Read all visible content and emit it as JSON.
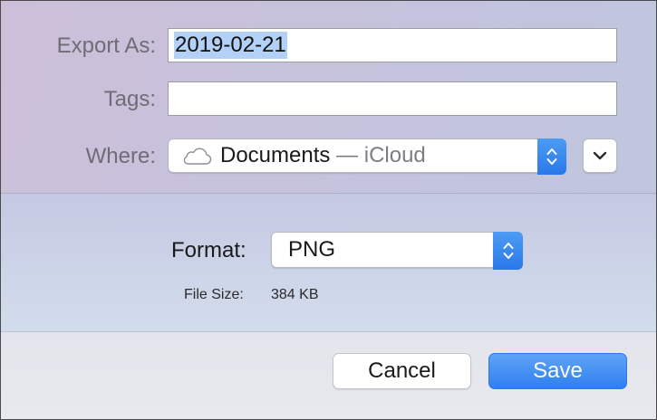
{
  "export_as": {
    "label": "Export As:",
    "value": "2019-02-21"
  },
  "tags": {
    "label": "Tags:",
    "value": ""
  },
  "where": {
    "label": "Where:",
    "location": "Documents",
    "separator": " — ",
    "service": "iCloud",
    "icon": "cloud-icon"
  },
  "format": {
    "label": "Format:",
    "selected": "PNG"
  },
  "file_size": {
    "label": "File Size:",
    "value": "384 KB"
  },
  "buttons": {
    "cancel": "Cancel",
    "save": "Save"
  },
  "colors": {
    "accent": "#2f7ff0",
    "selection": "#b3d1f7"
  }
}
